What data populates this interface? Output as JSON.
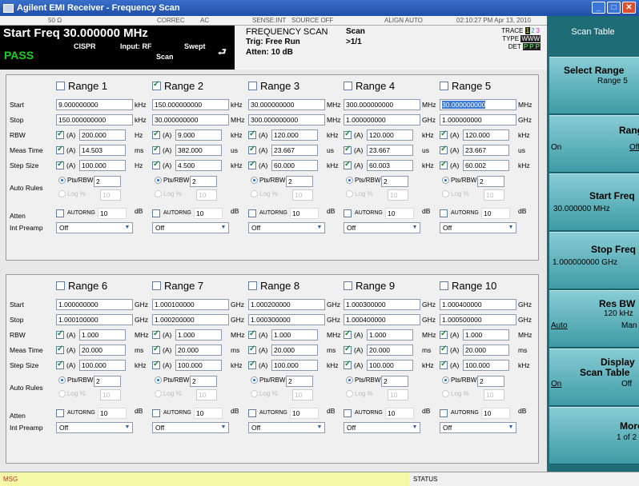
{
  "window": {
    "title": "Agilent EMI Receiver  - Frequency Scan"
  },
  "header": {
    "status_items": [
      "50 Ω",
      "CORREC",
      "AC",
      "SENSE:INT",
      "SOURCE OFF",
      "ALIGN AUTO",
      "02:10:27 PM Apr 13, 2010"
    ],
    "start_freq": "Start Freq  30.000000 MHz",
    "pass": "PASS",
    "cispr": "CISPR",
    "input": "Input: RF",
    "swept": "Swept",
    "scan": "Scan",
    "mode": "FREQUENCY SCAN",
    "trig": "Trig: Free Run",
    "atten": "Atten: 10 dB",
    "scan_label": "Scan",
    "scan_count": ">1/1",
    "trace_label": "TRACE",
    "trace_nums": [
      "1",
      "2",
      "3"
    ],
    "type_label": "TYPE",
    "type_val": "WWW",
    "det_label": "DET",
    "det_val": "P P P"
  },
  "labels": {
    "start": "Start",
    "stop": "Stop",
    "rbw": "RBW",
    "meas_time": "Meas Time",
    "step_size": "Step Size",
    "auto_rules": "Auto Rules",
    "atten": "Atten",
    "int_preamp": "Int Preamp",
    "auto": "(A)",
    "pts_rbw": "Pts/RBW",
    "log_pct": "Log %",
    "autorng": "AUTORNG",
    "db": "dB"
  },
  "ranges": [
    {
      "name": "Range 1",
      "checked": false,
      "start": "9.000000000",
      "start_unit": "kHz",
      "stop": "150.000000000",
      "stop_unit": "kHz",
      "rbw": "200.000",
      "rbw_unit": "Hz",
      "meas_time": "14.503",
      "meas_unit": "ms",
      "step": "100.000",
      "step_unit": "Hz",
      "pts": "2",
      "log": "10",
      "atten": "10",
      "preamp": "Off"
    },
    {
      "name": "Range 2",
      "checked": true,
      "start": "150.000000000",
      "start_unit": "kHz",
      "stop": "30.000000000",
      "stop_unit": "MHz",
      "rbw": "9.000",
      "rbw_unit": "kHz",
      "meas_time": "382.000",
      "meas_unit": "us",
      "step": "4.500",
      "step_unit": "kHz",
      "pts": "2",
      "log": "10",
      "atten": "10",
      "preamp": "Off"
    },
    {
      "name": "Range 3",
      "checked": false,
      "start": "30.000000000",
      "start_unit": "MHz",
      "stop": "300.000000000",
      "stop_unit": "MHz",
      "rbw": "120.000",
      "rbw_unit": "kHz",
      "meas_time": "23.667",
      "meas_unit": "us",
      "step": "60.000",
      "step_unit": "kHz",
      "pts": "2",
      "log": "10",
      "atten": "10",
      "preamp": "Off"
    },
    {
      "name": "Range 4",
      "checked": false,
      "start": "300.000000000",
      "start_unit": "MHz",
      "stop": "1.000000000",
      "stop_unit": "GHz",
      "rbw": "120.000",
      "rbw_unit": "kHz",
      "meas_time": "23.667",
      "meas_unit": "us",
      "step": "60.003",
      "step_unit": "kHz",
      "pts": "2",
      "log": "10",
      "atten": "10",
      "preamp": "Off"
    },
    {
      "name": "Range 5",
      "checked": false,
      "start": "30.000000000",
      "start_unit": "MHz",
      "stop": "1.000000000",
      "stop_unit": "GHz",
      "rbw": "120.000",
      "rbw_unit": "kHz",
      "meas_time": "23.667",
      "meas_unit": "us",
      "step": "60.002",
      "step_unit": "kHz",
      "pts": "2",
      "log": "10",
      "atten": "10",
      "preamp": "Off",
      "selected": true
    },
    {
      "name": "Range 6",
      "checked": false,
      "start": "1.000000000",
      "start_unit": "GHz",
      "stop": "1.000100000",
      "stop_unit": "GHz",
      "rbw": "1.000",
      "rbw_unit": "MHz",
      "meas_time": "20.000",
      "meas_unit": "ms",
      "step": "100.000",
      "step_unit": "kHz",
      "pts": "2",
      "log": "10",
      "atten": "10",
      "preamp": "Off"
    },
    {
      "name": "Range 7",
      "checked": false,
      "start": "1.000100000",
      "start_unit": "GHz",
      "stop": "1.000200000",
      "stop_unit": "GHz",
      "rbw": "1.000",
      "rbw_unit": "MHz",
      "meas_time": "20.000",
      "meas_unit": "ms",
      "step": "100.000",
      "step_unit": "kHz",
      "pts": "2",
      "log": "10",
      "atten": "10",
      "preamp": "Off"
    },
    {
      "name": "Range 8",
      "checked": false,
      "start": "1.000200000",
      "start_unit": "GHz",
      "stop": "1.000300000",
      "stop_unit": "GHz",
      "rbw": "1.000",
      "rbw_unit": "MHz",
      "meas_time": "20.000",
      "meas_unit": "ms",
      "step": "100.000",
      "step_unit": "kHz",
      "pts": "2",
      "log": "10",
      "atten": "10",
      "preamp": "Off"
    },
    {
      "name": "Range 9",
      "checked": false,
      "start": "1.000300000",
      "start_unit": "GHz",
      "stop": "1.000400000",
      "stop_unit": "GHz",
      "rbw": "1.000",
      "rbw_unit": "MHz",
      "meas_time": "20.000",
      "meas_unit": "ms",
      "step": "100.000",
      "step_unit": "kHz",
      "pts": "2",
      "log": "10",
      "atten": "10",
      "preamp": "Off"
    },
    {
      "name": "Range 10",
      "checked": false,
      "start": "1.000400000",
      "start_unit": "GHz",
      "stop": "1.000500000",
      "stop_unit": "GHz",
      "rbw": "1.000",
      "rbw_unit": "MHz",
      "meas_time": "20.000",
      "meas_unit": "ms",
      "step": "100.000",
      "step_unit": "kHz",
      "pts": "2",
      "log": "10",
      "atten": "10",
      "preamp": "Off"
    }
  ],
  "softkeys": {
    "header": "Scan Table",
    "select_range": {
      "title": "Select Range",
      "value": "Range 5"
    },
    "range": {
      "title": "Range",
      "on": "On",
      "off": "Off"
    },
    "start_freq": {
      "title": "Start Freq",
      "value": "30.000000 MHz"
    },
    "stop_freq": {
      "title": "Stop Freq",
      "value": "1.000000000 GHz"
    },
    "res_bw": {
      "title": "Res BW",
      "value": "120 kHz",
      "auto": "Auto",
      "man": "Man"
    },
    "display": {
      "title1": "Display",
      "title2": "Scan Table",
      "on": "On",
      "off": "Off"
    },
    "more": {
      "title": "More",
      "value": "1 of 2"
    }
  },
  "statusbar": {
    "msg": "MSG",
    "status": "STATUS"
  }
}
